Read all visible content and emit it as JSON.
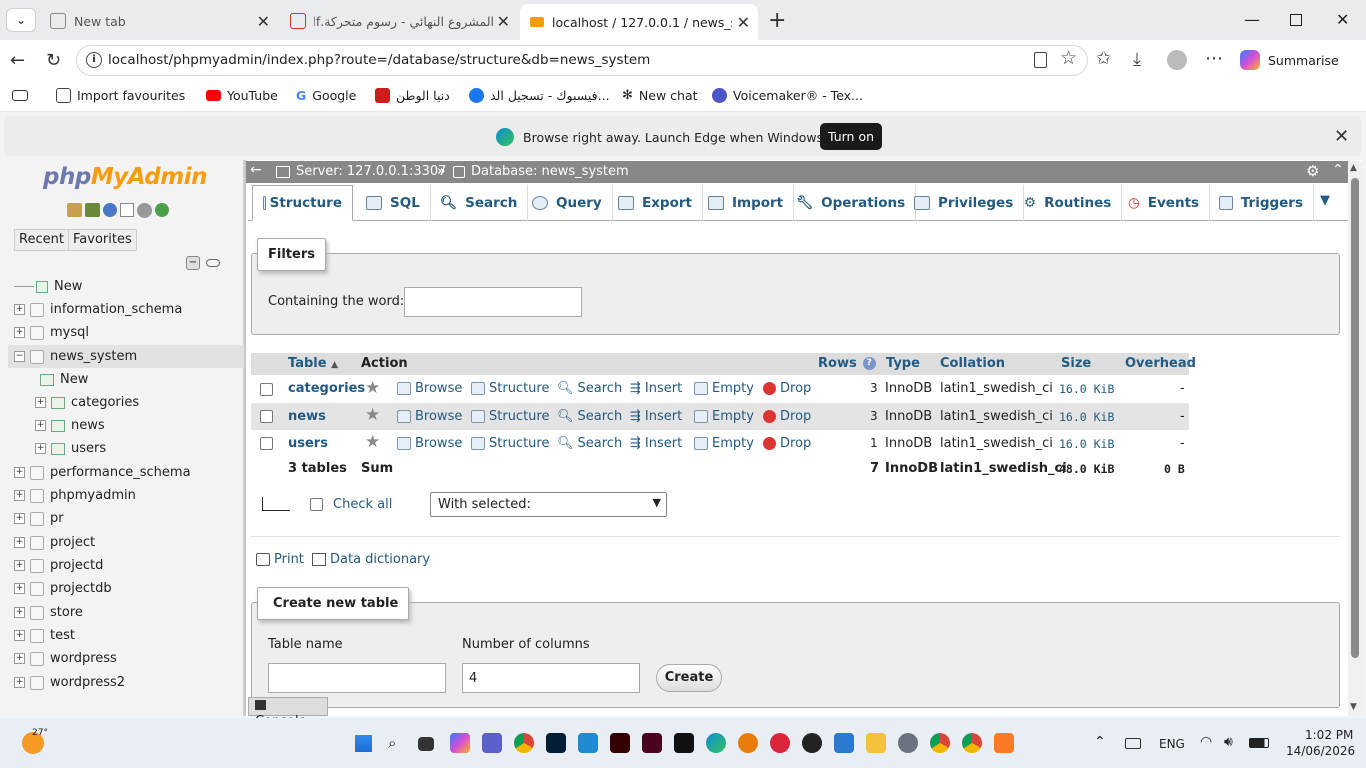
{
  "browser": {
    "tabs": [
      {
        "title": "New tab"
      },
      {
        "title": "المشروع النهائي - رسوم متحركة.pdf"
      },
      {
        "title": "localhost / 127.0.0.1 / news_system"
      }
    ],
    "url": "localhost/phpmyadmin/index.php?route=/database/structure&db=news_system",
    "profile_label": "Summarise",
    "bookmarks": [
      "Import favourites",
      "YouTube",
      "Google",
      "دنيا الوطن",
      "فيسبوك - تسجيل الد...",
      "New chat",
      "Voicemaker® - Tex..."
    ],
    "infobar_text": "Browse right away. Launch Edge when Windows starts.",
    "infobar_button": "Turn on",
    "colors": {
      "accent": "#0b57d0",
      "youtube": "#ff0000",
      "facebook": "#1877f2"
    }
  },
  "pma": {
    "logo_php": "php",
    "logo_myadmin": "MyAdmin",
    "recent_btn": "Recent",
    "favorites_btn": "Favorites",
    "tree": [
      {
        "label": "New",
        "level": 0,
        "type": "new"
      },
      {
        "label": "information_schema",
        "level": 0,
        "type": "db"
      },
      {
        "label": "mysql",
        "level": 0,
        "type": "db"
      },
      {
        "label": "news_system",
        "level": 0,
        "type": "db-open"
      },
      {
        "label": "New",
        "level": 1,
        "type": "new"
      },
      {
        "label": "categories",
        "level": 1,
        "type": "table"
      },
      {
        "label": "news",
        "level": 1,
        "type": "table"
      },
      {
        "label": "users",
        "level": 1,
        "type": "table"
      },
      {
        "label": "performance_schema",
        "level": 0,
        "type": "db"
      },
      {
        "label": "phpmyadmin",
        "level": 0,
        "type": "db"
      },
      {
        "label": "pr",
        "level": 0,
        "type": "db"
      },
      {
        "label": "project",
        "level": 0,
        "type": "db"
      },
      {
        "label": "projectd",
        "level": 0,
        "type": "db"
      },
      {
        "label": "projectdb",
        "level": 0,
        "type": "db"
      },
      {
        "label": "store",
        "level": 0,
        "type": "db"
      },
      {
        "label": "test",
        "level": 0,
        "type": "db"
      },
      {
        "label": "wordpress",
        "level": 0,
        "type": "db"
      },
      {
        "label": "wordpress2",
        "level": 0,
        "type": "db"
      }
    ],
    "breadcrumb_server": "Server: 127.0.0.1:3307",
    "breadcrumb_sep": "»",
    "breadcrumb_db": "Database: news_system",
    "tabs": [
      "Structure",
      "SQL",
      "Search",
      "Query",
      "Export",
      "Import",
      "Operations",
      "Privileges",
      "Routines",
      "Events",
      "Triggers"
    ],
    "filters_legend": "Filters",
    "filters_label": "Containing the word:",
    "headers": {
      "table": "Table",
      "action": "Action",
      "rows": "Rows",
      "type": "Type",
      "collation": "Collation",
      "size": "Size",
      "overhead": "Overhead"
    },
    "action_labels": {
      "browse": "Browse",
      "structure": "Structure",
      "search": "Search",
      "insert": "Insert",
      "empty": "Empty",
      "drop": "Drop"
    },
    "rows": [
      {
        "name": "categories",
        "rows": "3",
        "type": "InnoDB",
        "collation": "latin1_swedish_ci",
        "size": "16.0 KiB",
        "overhead": "-"
      },
      {
        "name": "news",
        "rows": "3",
        "type": "InnoDB",
        "collation": "latin1_swedish_ci",
        "size": "16.0 KiB",
        "overhead": "-"
      },
      {
        "name": "users",
        "rows": "1",
        "type": "InnoDB",
        "collation": "latin1_swedish_ci",
        "size": "16.0 KiB",
        "overhead": "-"
      }
    ],
    "summary": {
      "tables": "3 tables",
      "sum": "Sum",
      "rows": "7",
      "type": "InnoDB",
      "collation": "latin1_swedish_ci",
      "size": "48.0 KiB",
      "overhead": "0 B"
    },
    "check_all": "Check all",
    "with_selected": "With selected:",
    "print": "Print",
    "data_dictionary": "Data dictionary",
    "create_legend": "Create new table",
    "table_name_label": "Table name",
    "num_columns_label": "Number of columns",
    "num_columns_value": "4",
    "create_btn": "Create",
    "console": "Console"
  },
  "taskbar": {
    "weather": "27°",
    "lang": "ENG",
    "time": "1:02 PM",
    "date": "14/06/2026"
  }
}
